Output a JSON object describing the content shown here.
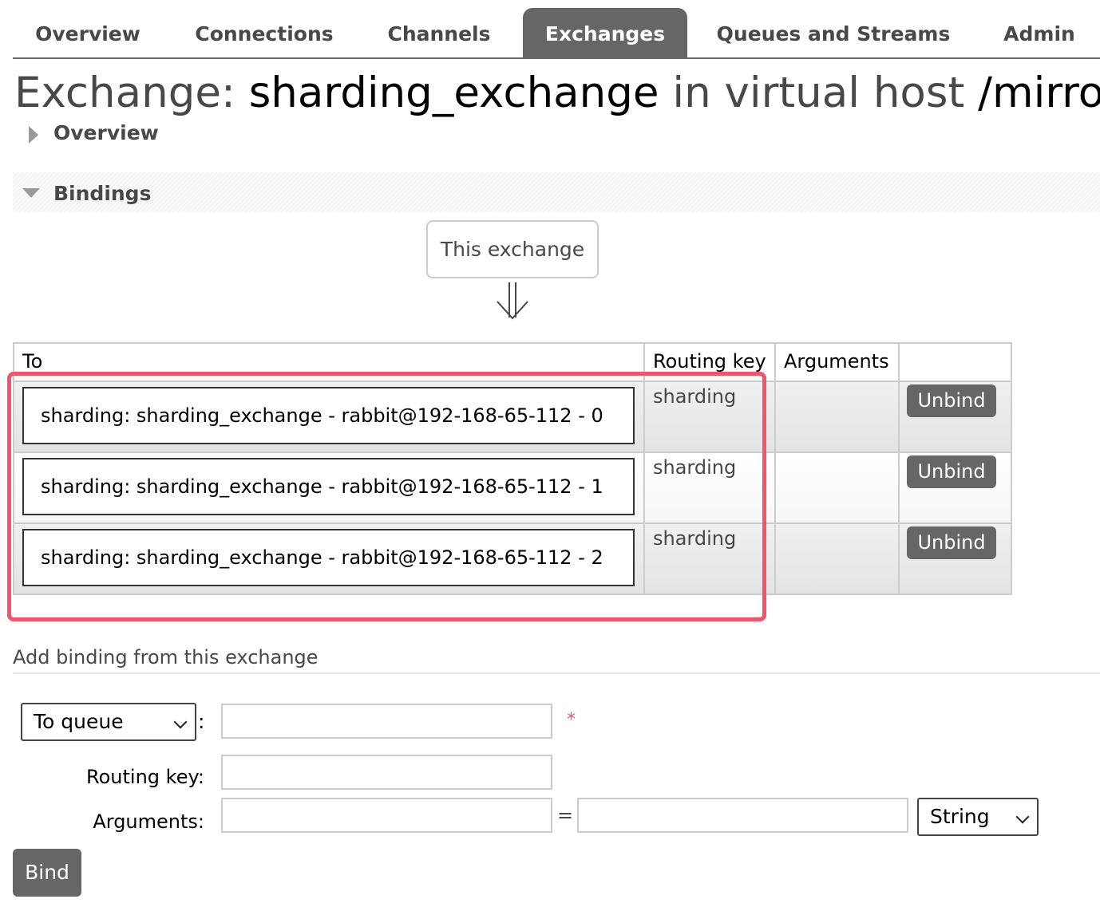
{
  "nav": {
    "tabs": [
      {
        "label": "Overview"
      },
      {
        "label": "Connections"
      },
      {
        "label": "Channels"
      },
      {
        "label": "Exchanges",
        "active": true
      },
      {
        "label": "Queues and Streams"
      },
      {
        "label": "Admin"
      }
    ]
  },
  "title": {
    "prefix": "Exchange:",
    "exchange_name": "sharding_exchange",
    "middle": "in virtual host",
    "vhost": "/mirror"
  },
  "sections": {
    "overview": "Overview",
    "bindings": "Bindings"
  },
  "bindings": {
    "source_label": "This exchange",
    "headers": {
      "to": "To",
      "routing_key": "Routing key",
      "arguments": "Arguments"
    },
    "rows": [
      {
        "to": "sharding: sharding_exchange - rabbit@192-168-65-112 - 0",
        "routing_key": "sharding",
        "arguments": "",
        "action": "Unbind"
      },
      {
        "to": "sharding: sharding_exchange - rabbit@192-168-65-112 - 1",
        "routing_key": "sharding",
        "arguments": "",
        "action": "Unbind"
      },
      {
        "to": "sharding: sharding_exchange - rabbit@192-168-65-112 - 2",
        "routing_key": "sharding",
        "arguments": "",
        "action": "Unbind"
      }
    ]
  },
  "add_binding": {
    "title": "Add binding from this exchange",
    "destination_type": "To queue",
    "destination_value": "",
    "required_marker": "*",
    "routing_key_label": "Routing key:",
    "routing_key_value": "",
    "arguments_label": "Arguments:",
    "argument_key": "",
    "equals": "=",
    "argument_value": "",
    "argument_type": "String",
    "bind_label": "Bind"
  },
  "colors": {
    "tab_active_bg": "#666666",
    "button_bg": "#666666",
    "highlight": "#f2546a"
  }
}
